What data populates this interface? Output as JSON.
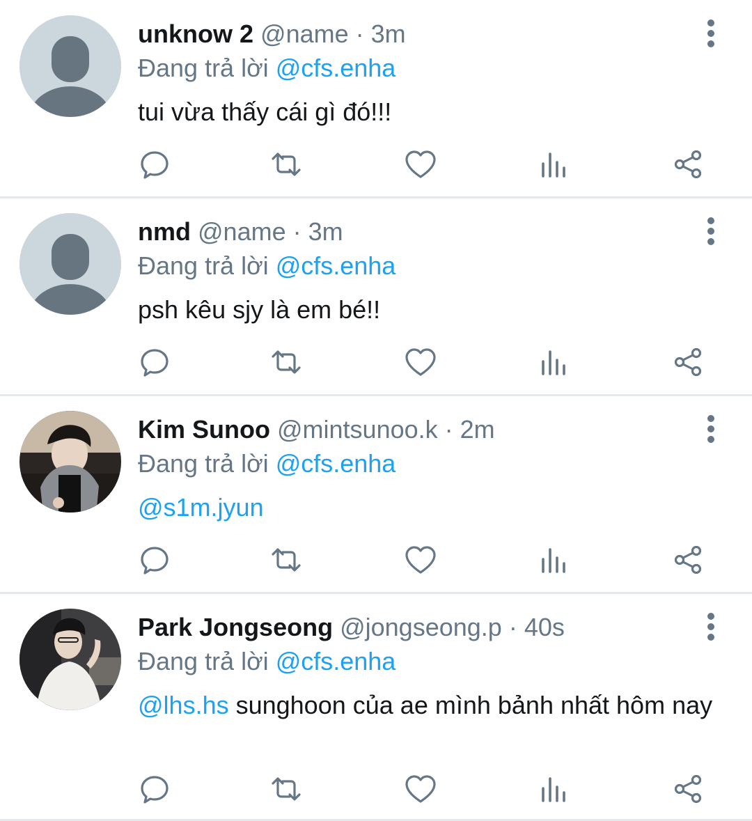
{
  "replies": [
    {
      "name": "unknow 2",
      "handle": "@name",
      "sep": " · ",
      "time": "3m",
      "reply_prefix": "Đang trả lời ",
      "reply_to": "@cfs.enha",
      "body_mention": "",
      "body_text": "tui vừa thấy cái gì đó!!!",
      "avatar": "default-avatar"
    },
    {
      "name": "nmd",
      "handle": "@name",
      "sep": " · ",
      "time": "3m",
      "reply_prefix": "Đang trả lời ",
      "reply_to": "@cfs.enha",
      "body_mention": "",
      "body_text": "psh kêu sjy là em bé!!",
      "avatar": "default-avatar"
    },
    {
      "name": "Kim Sunoo",
      "handle": "@mintsunoo.k",
      "sep": " · ",
      "time": "2m",
      "reply_prefix": "Đang trả lời ",
      "reply_to": "@cfs.enha",
      "body_mention": "@s1m.jyun",
      "body_text": "",
      "avatar": "photo-avatar"
    },
    {
      "name": "Park Jongseong",
      "handle": "@jongseong.p",
      "sep": " · ",
      "time": "40s",
      "reply_prefix": "Đang trả lời ",
      "reply_to": "@cfs.enha",
      "body_mention": "@lhs.hs",
      "body_text": " sunghoon của ae mình bảnh nhất hôm nay",
      "avatar": "photo-avatar"
    }
  ],
  "icons": {
    "reply": "speech-bubble-icon",
    "retweet": "retweet-icon",
    "like": "heart-icon",
    "analytics": "bar-chart-icon",
    "share": "share-icon",
    "more": "vertical-dots-icon"
  },
  "colors": {
    "name": "#14171a",
    "secondary": "#657786",
    "mention": "#1da1f2",
    "divider": "#e6e9ec"
  }
}
